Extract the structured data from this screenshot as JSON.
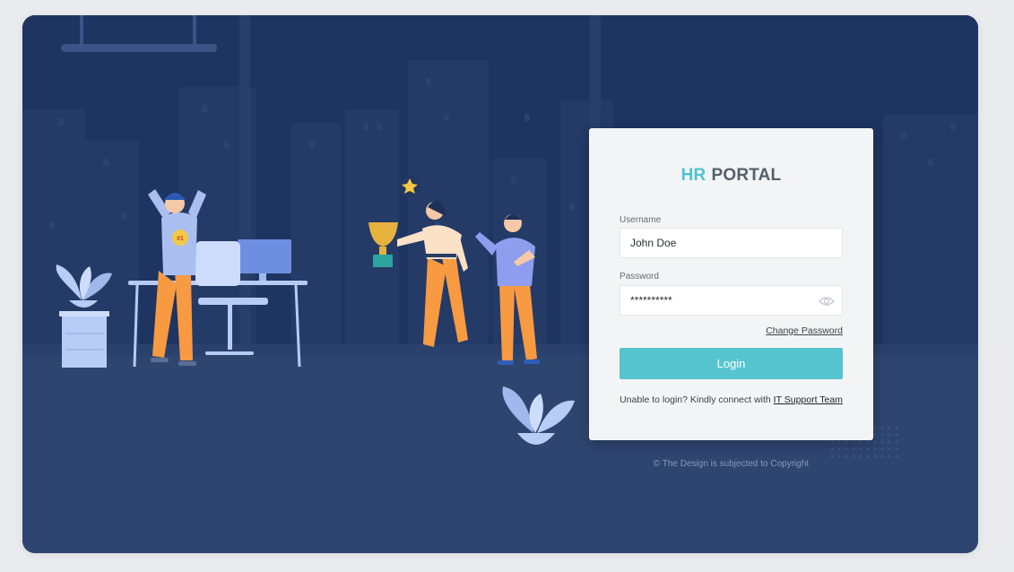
{
  "brand": {
    "prefix": "HR",
    "suffix": "PORTAL"
  },
  "form": {
    "username_label": "Username",
    "username_value": "John Doe",
    "password_label": "Password",
    "password_value": "**********",
    "show_password_icon": "eye-icon",
    "change_password": "Change Password",
    "login_button": "Login",
    "help_text": "Unable to login? Kindly connect with",
    "help_link": "IT Support Team"
  },
  "footer": {
    "copyright": "© The Design is subjected to Copyright"
  },
  "illustration": {
    "badge_text": "#1"
  },
  "colors": {
    "accent": "#56c4cf",
    "background": "#1e3461",
    "floor": "#2e4570"
  }
}
